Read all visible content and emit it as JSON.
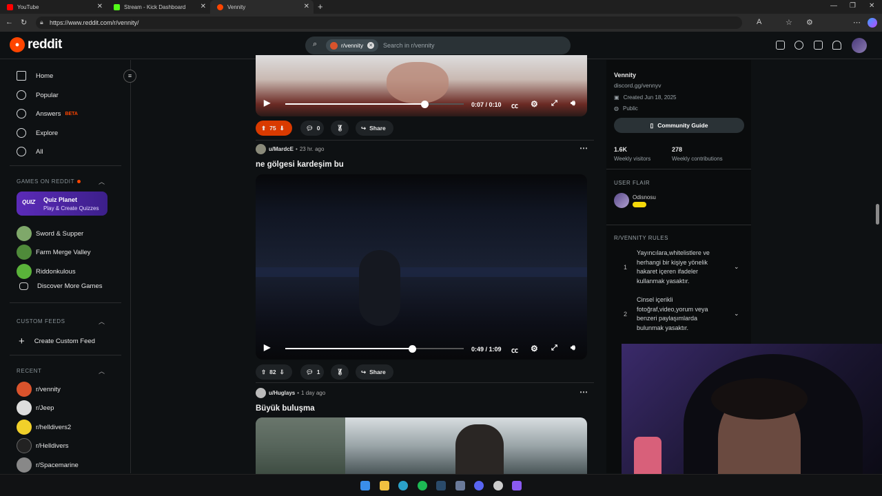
{
  "browser": {
    "tabs": [
      {
        "title": "YouTube",
        "color": "#ff0000"
      },
      {
        "title": "Stream - Kick Dashboard",
        "color": "#53fc18"
      },
      {
        "title": "Vennity",
        "color": "#ff4500"
      }
    ],
    "url": "https://www.reddit.com/r/vennity/"
  },
  "header": {
    "logo_text": "reddit",
    "search_chip": "r/vennity",
    "search_placeholder": "Search in r/vennity"
  },
  "sidebar": {
    "nav": [
      {
        "label": "Home"
      },
      {
        "label": "Popular"
      },
      {
        "label": "Answers",
        "badge": "BETA"
      },
      {
        "label": "Explore"
      },
      {
        "label": "All"
      }
    ],
    "games_section": "GAMES ON REDDIT",
    "quiz": {
      "title": "Quiz Planet",
      "subtitle": "Play & Create Quizzes",
      "icon_text": "QUIZ"
    },
    "games": [
      "Sword & Supper",
      "Farm Merge Valley",
      "Riddonkulous",
      "Discover More Games"
    ],
    "custom_section": "CUSTOM FEEDS",
    "create_feed": "Create Custom Feed",
    "recent_section": "RECENT",
    "recent": [
      "r/vennity",
      "r/Jeep",
      "r/helldivers2",
      "r/Helldivers",
      "r/Spacemarine"
    ]
  },
  "posts": [
    {
      "time_label": "0:07 / 0:10",
      "progress": 0.78,
      "votes": "75",
      "comments": "0",
      "share": "Share"
    },
    {
      "author": "u/MardcE",
      "age": "23 hr. ago",
      "title": "ne gölgesi kardeşim bu",
      "time_label": "0:49 / 1:09",
      "progress": 0.71,
      "votes": "82",
      "comments": "1",
      "share": "Share"
    },
    {
      "author": "u/Huglays",
      "age": "1 day ago",
      "title": "Büyük buluşma"
    }
  ],
  "community": {
    "name": "Vennity",
    "link": "discord.gg/vennyv",
    "created": "Created Jun 18, 2025",
    "visibility": "Public",
    "guide_button": "Community Guide",
    "visitors": "1.6K",
    "visitors_label": "Weekly visitors",
    "contributions": "278",
    "contributions_label": "Weekly contributions",
    "flair_section": "USER FLAIR",
    "flair_user": "Odisnosu",
    "rules_section": "R/VENNITY RULES",
    "rules": [
      {
        "num": "1",
        "text": "Yayıncılara,whitelistlere ve herhangi bir kişiye yönelik hakaret içeren ifadeler kullanmak yasaktır."
      },
      {
        "num": "2",
        "text": "Cinsel içerikli fotoğraf,video,yorum veya benzeri paylaşımlarda bulunmak yasaktır."
      }
    ]
  }
}
